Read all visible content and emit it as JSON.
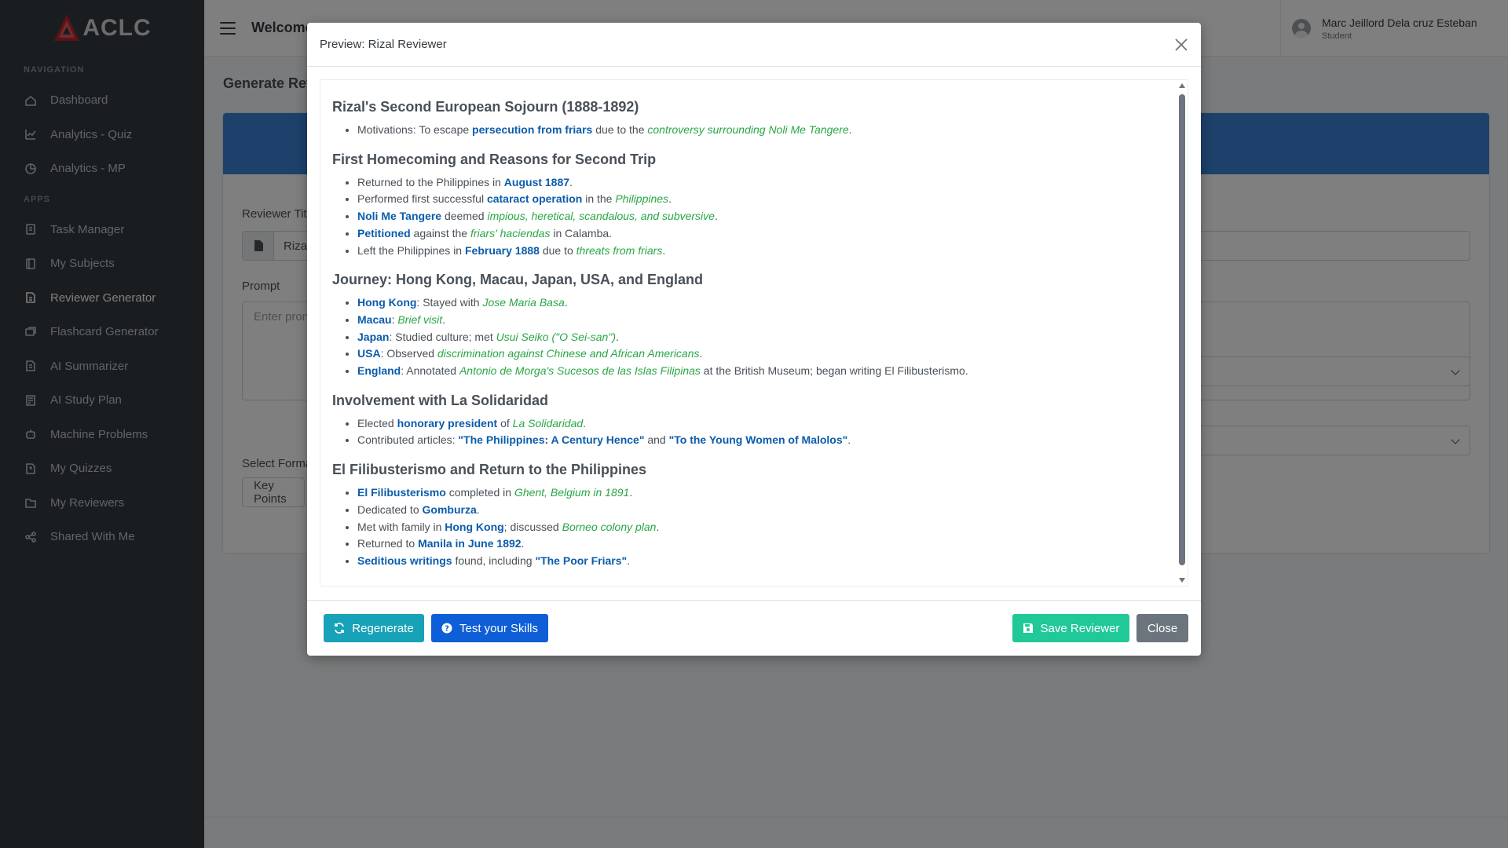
{
  "brand": {
    "name": "ACLC",
    "accent": "#d9363e"
  },
  "sidebar": {
    "nav_header": "NAVIGATION",
    "apps_header": "APPS",
    "nav_items": [
      {
        "label": "Dashboard",
        "icon": "home-icon"
      },
      {
        "label": "Analytics - Quiz",
        "icon": "chart-line-icon"
      },
      {
        "label": "Analytics - MP",
        "icon": "chart-pie-icon"
      }
    ],
    "app_items": [
      {
        "label": "Task Manager",
        "icon": "clipboard-icon"
      },
      {
        "label": "My Subjects",
        "icon": "book-icon"
      },
      {
        "label": "Reviewer Generator",
        "icon": "file-generate-icon",
        "active": true
      },
      {
        "label": "Flashcard Generator",
        "icon": "cards-icon"
      },
      {
        "label": "AI Summarizer",
        "icon": "document-icon"
      },
      {
        "label": "AI Study Plan",
        "icon": "map-icon"
      },
      {
        "label": "Machine Problems",
        "icon": "robot-icon"
      },
      {
        "label": "My Quizzes",
        "icon": "quiz-icon"
      },
      {
        "label": "My Reviewers",
        "icon": "folder-icon"
      },
      {
        "label": "Shared With Me",
        "icon": "share-icon"
      }
    ]
  },
  "header": {
    "welcome": "Welcome",
    "user_name": "Marc Jeillord Dela cruz Esteban",
    "user_role": "Student"
  },
  "page": {
    "title": "Generate Rev",
    "reviewer_title_label": "Reviewer Tit",
    "reviewer_title_value": "Riza",
    "prompt_label": "Prompt",
    "prompt_placeholder": "Enter pron",
    "format_label": "Select Forma",
    "format_value": "Key Points"
  },
  "modal": {
    "title": "Preview: Rizal Reviewer",
    "buttons": {
      "regenerate": "Regenerate",
      "test": "Test your Skills",
      "save": "Save Reviewer",
      "close": "Close"
    },
    "sections": [
      {
        "heading": "Rizal's Second European Sojourn (1888-1892)",
        "items": [
          [
            [
              "t",
              "Motivations: To escape "
            ],
            [
              "k",
              "persecution from friars"
            ],
            [
              "t",
              " due to the "
            ],
            [
              "e",
              "controversy surrounding Noli Me Tangere"
            ],
            [
              "t",
              "."
            ]
          ]
        ]
      },
      {
        "heading": "First Homecoming and Reasons for Second Trip",
        "items": [
          [
            [
              "t",
              "Returned to the Philippines in "
            ],
            [
              "k",
              "August 1887"
            ],
            [
              "t",
              "."
            ]
          ],
          [
            [
              "t",
              "Performed first successful "
            ],
            [
              "k",
              "cataract operation"
            ],
            [
              "t",
              " in the "
            ],
            [
              "e",
              "Philippines"
            ],
            [
              "t",
              "."
            ]
          ],
          [
            [
              "k",
              "Noli Me Tangere"
            ],
            [
              "t",
              " deemed "
            ],
            [
              "e",
              "impious, heretical, scandalous, and subversive"
            ],
            [
              "t",
              "."
            ]
          ],
          [
            [
              "k",
              "Petitioned"
            ],
            [
              "t",
              " against the "
            ],
            [
              "e",
              "friars' haciendas"
            ],
            [
              "t",
              " in Calamba."
            ]
          ],
          [
            [
              "t",
              "Left the Philippines in "
            ],
            [
              "k",
              "February 1888"
            ],
            [
              "t",
              " due to "
            ],
            [
              "e",
              "threats from friars"
            ],
            [
              "t",
              "."
            ]
          ]
        ]
      },
      {
        "heading": "Journey: Hong Kong, Macau, Japan, USA, and England",
        "items": [
          [
            [
              "k",
              "Hong Kong"
            ],
            [
              "t",
              ": Stayed with "
            ],
            [
              "e",
              "Jose Maria Basa"
            ],
            [
              "t",
              "."
            ]
          ],
          [
            [
              "k",
              "Macau"
            ],
            [
              "t",
              ": "
            ],
            [
              "e",
              "Brief visit"
            ],
            [
              "t",
              "."
            ]
          ],
          [
            [
              "k",
              "Japan"
            ],
            [
              "t",
              ": Studied culture; met "
            ],
            [
              "e",
              "Usui Seiko (\"O Sei-san\")"
            ],
            [
              "t",
              "."
            ]
          ],
          [
            [
              "k",
              "USA"
            ],
            [
              "t",
              ": Observed "
            ],
            [
              "e",
              "discrimination against Chinese and African Americans"
            ],
            [
              "t",
              "."
            ]
          ],
          [
            [
              "k",
              "England"
            ],
            [
              "t",
              ": Annotated "
            ],
            [
              "e",
              "Antonio de Morga's Sucesos de las Islas Filipinas"
            ],
            [
              "t",
              " at the British Museum; began writing El Filibusterismo."
            ]
          ]
        ]
      },
      {
        "heading": "Involvement with La Solidaridad",
        "items": [
          [
            [
              "t",
              "Elected "
            ],
            [
              "k",
              "honorary president"
            ],
            [
              "t",
              " of "
            ],
            [
              "e",
              "La Solidaridad"
            ],
            [
              "t",
              "."
            ]
          ],
          [
            [
              "t",
              "Contributed articles: "
            ],
            [
              "k",
              "\"The Philippines: A Century Hence\""
            ],
            [
              "t",
              " and "
            ],
            [
              "k",
              "\"To the Young Women of Malolos\""
            ],
            [
              "t",
              "."
            ]
          ]
        ]
      },
      {
        "heading": "El Filibusterismo and Return to the Philippines",
        "items": [
          [
            [
              "k",
              "El Filibusterismo"
            ],
            [
              "t",
              " completed in "
            ],
            [
              "e",
              "Ghent, Belgium in 1891"
            ],
            [
              "t",
              "."
            ]
          ],
          [
            [
              "t",
              "Dedicated to "
            ],
            [
              "k",
              "Gomburza"
            ],
            [
              "t",
              "."
            ]
          ],
          [
            [
              "t",
              "Met with family in "
            ],
            [
              "k",
              "Hong Kong"
            ],
            [
              "t",
              "; discussed "
            ],
            [
              "e",
              "Borneo colony plan"
            ],
            [
              "t",
              "."
            ]
          ],
          [
            [
              "t",
              "Returned to "
            ],
            [
              "k",
              "Manila in June 1892"
            ],
            [
              "t",
              "."
            ]
          ],
          [
            [
              "k",
              "Seditious writings"
            ],
            [
              "t",
              " found, including "
            ],
            [
              "k",
              "\"The Poor Friars\""
            ],
            [
              "t",
              "."
            ]
          ]
        ]
      }
    ]
  },
  "colors": {
    "sidebar_bg": "#343a40",
    "keyword": "#0b5cab",
    "emphasis": "#28a745",
    "regenerate_btn": "#17a2b8",
    "test_btn": "#0d5ed7",
    "save_btn": "#20c997",
    "close_btn": "#6c757d",
    "card_header": "#3a83d6"
  }
}
